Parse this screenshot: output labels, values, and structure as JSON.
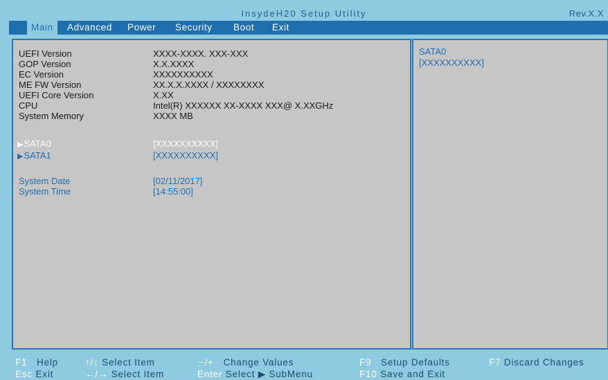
{
  "title": "InsydeH20 Setup Utility",
  "revision": "Rev.X.X",
  "menu": [
    "Main",
    "Advanced",
    "Power",
    "Security",
    "Boot",
    "Exit"
  ],
  "info_rows": [
    {
      "label": "UEFI Version",
      "value": "XXXX-XXXX. XXX-XXX"
    },
    {
      "label": "GOP Version",
      "value": "X.X.XXXX"
    },
    {
      "label": "EC Version",
      "value": "XXXXXXXXXX"
    },
    {
      "label": "ME FW Version",
      "value": "XX.X.X.XXXX / XXXXXXXX"
    },
    {
      "label": "UEFI Core Version",
      "value": "X.XX"
    },
    {
      "label": "CPU",
      "value": "Intel(R) XXXXXX XX-XXXX XXX@ X.XXGHz"
    },
    {
      "label": "System Memory",
      "value": "XXXX MB"
    }
  ],
  "submenu_rows": [
    {
      "arrow": "▶",
      "label": "SATA0",
      "value": "[XXXXXXXXXX]"
    },
    {
      "arrow": "▶",
      "label": "SATA1",
      "value": "[XXXXXXXXXX]"
    }
  ],
  "setting_rows": [
    {
      "label": "System Date",
      "value": "[02/11/2017]"
    },
    {
      "label": "System Time",
      "value": "[14:55:00]"
    }
  ],
  "help": {
    "title": "SATA0",
    "value": "[XXXXXXXXXX]"
  },
  "footer": {
    "f1_key": "F1",
    "f1_desc": "Help",
    "esc_key": "Esc",
    "esc_desc": "Exit",
    "updown_key": "↑/↓",
    "updown_desc": "Select  Item",
    "leftright_key": "←/→",
    "leftright_desc": "Select  Item",
    "plusminus_key": "−/+",
    "plusminus_desc": "Change  Values",
    "enter_key": "Enter",
    "enter_desc": "Select  ▶  SubMenu",
    "f9_key": "F9",
    "f9_desc": "Setup  Defaults",
    "f10_key": "F10",
    "f10_desc": "Save  and  Exit",
    "f7_key": "F7",
    "f7_desc": "Discard  Changes"
  },
  "colors": {
    "background": "#8fcbe0",
    "menubar": "#1f6eae",
    "panel": "#c6c6c6",
    "link_text": "#1f6eae",
    "selected_text": "#ffffff"
  }
}
